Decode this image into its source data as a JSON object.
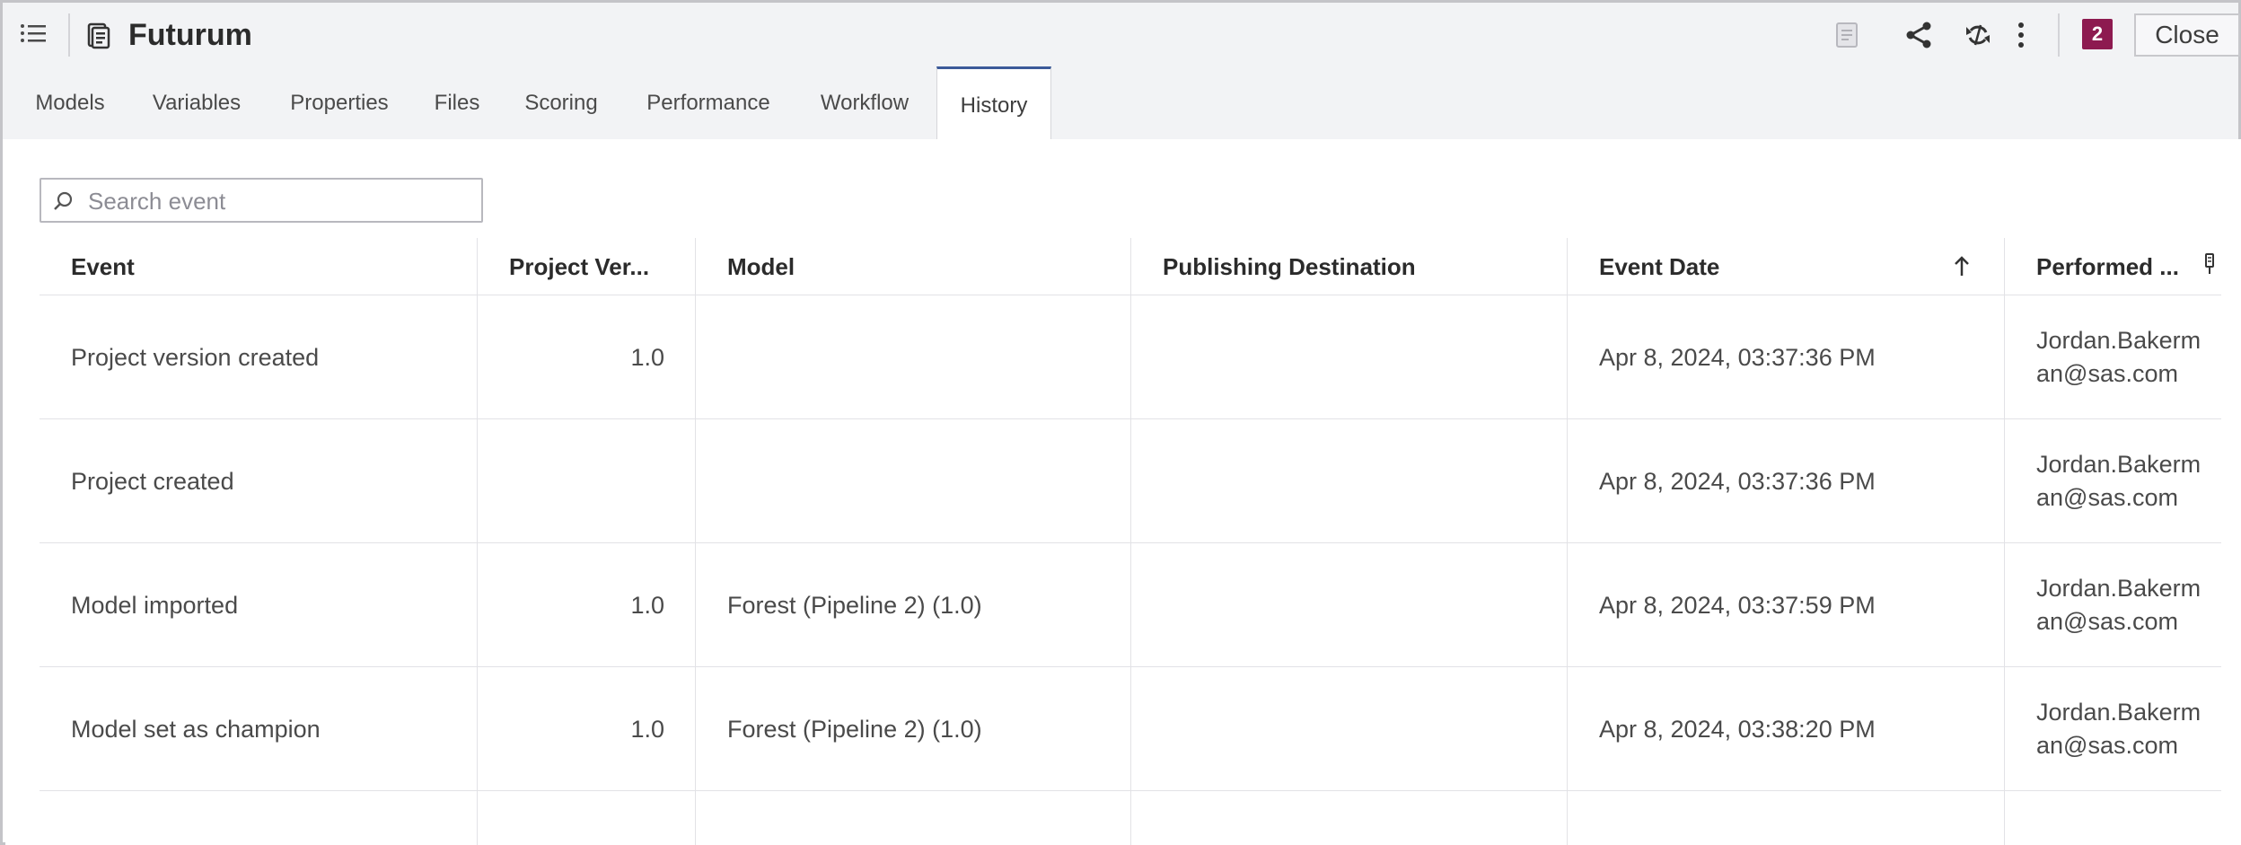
{
  "header": {
    "title": "Futurum",
    "badge_count": "2",
    "close_label": "Close",
    "icons": [
      "list-icon",
      "project-icon",
      "notes-icon",
      "share-icon",
      "refresh-icon",
      "more-options-icon"
    ]
  },
  "tabs": [
    {
      "label": "Models",
      "active": false
    },
    {
      "label": "Variables",
      "active": false
    },
    {
      "label": "Properties",
      "active": false
    },
    {
      "label": "Files",
      "active": false
    },
    {
      "label": "Scoring",
      "active": false
    },
    {
      "label": "Performance",
      "active": false
    },
    {
      "label": "Workflow",
      "active": false
    },
    {
      "label": "History",
      "active": true
    }
  ],
  "search": {
    "placeholder": "Search event",
    "value": ""
  },
  "table": {
    "columns": [
      "Event",
      "Project Ver...",
      "Model",
      "Publishing Destination",
      "Event Date",
      "Performed ..."
    ],
    "sort_column": "Event Date",
    "sort_direction": "ascending",
    "rows": [
      {
        "event": "Project version created",
        "project_version": "1.0",
        "model": "",
        "publishing_destination": "",
        "event_date": "Apr 8, 2024, 03:37:36 PM",
        "performed_by": "Jordan.Bakerman@sas.com"
      },
      {
        "event": "Project created",
        "project_version": "",
        "model": "",
        "publishing_destination": "",
        "event_date": "Apr 8, 2024, 03:37:36 PM",
        "performed_by": "Jordan.Bakerman@sas.com"
      },
      {
        "event": "Model imported",
        "project_version": "1.0",
        "model": "Forest (Pipeline 2) (1.0)",
        "publishing_destination": "",
        "event_date": "Apr 8, 2024, 03:37:59 PM",
        "performed_by": "Jordan.Bakerman@sas.com"
      },
      {
        "event": "Model set as champion",
        "project_version": "1.0",
        "model": "Forest (Pipeline 2) (1.0)",
        "publishing_destination": "",
        "event_date": "Apr 8, 2024, 03:38:20 PM",
        "performed_by": "Jordan.Bakerman@sas.com"
      }
    ]
  },
  "colors": {
    "accent": "#3c5a99",
    "badge": "#8d1a50",
    "header_bg": "#f2f3f5"
  }
}
